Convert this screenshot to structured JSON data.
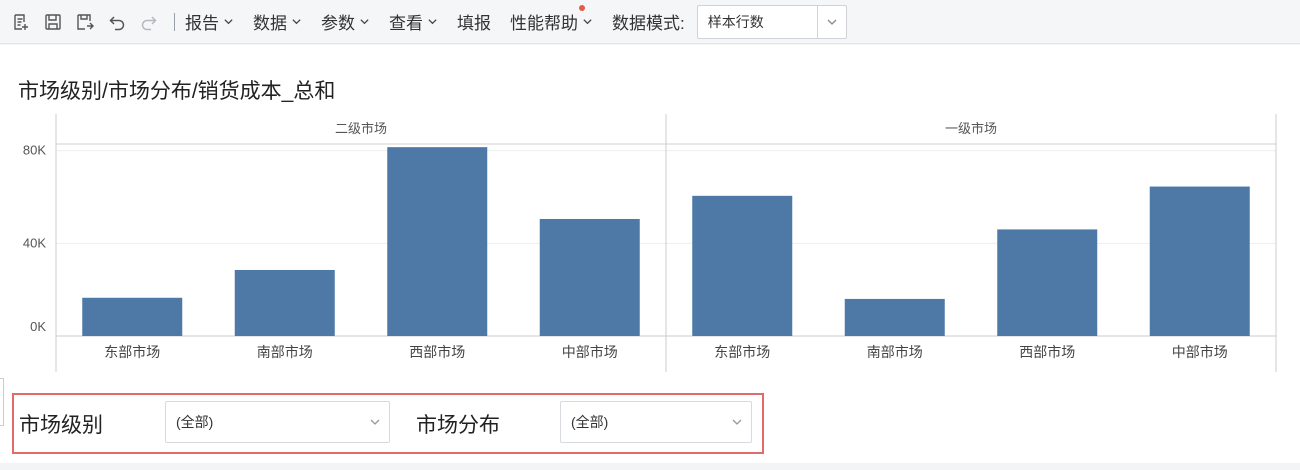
{
  "toolbar": {
    "icons": [
      "new-report-icon",
      "save-icon",
      "save-as-icon",
      "undo-icon",
      "redo-icon"
    ],
    "menus": [
      {
        "label": "报告",
        "dot": false
      },
      {
        "label": "数据",
        "dot": false
      },
      {
        "label": "参数",
        "dot": false
      },
      {
        "label": "查看",
        "dot": false
      },
      {
        "label": "填报",
        "dot": false,
        "nochev": true
      },
      {
        "label": "性能帮助",
        "dot": true
      }
    ],
    "data_mode_label": "数据模式:",
    "data_mode_value": "样本行数"
  },
  "colors": {
    "bar": "#4e79a7",
    "dot": "#e45b4a",
    "filter_border": "#e26a6a"
  },
  "chart_title": "市场级别/市场分布/销货成本_总和",
  "chart_data": {
    "type": "bar",
    "title": "市场级别/市场分布/销货成本_总和",
    "ylim": [
      0,
      82000
    ],
    "yticks": [
      {
        "value": 0,
        "label": "0K"
      },
      {
        "value": 40000,
        "label": "40K"
      },
      {
        "value": 80000,
        "label": "80K"
      }
    ],
    "grid": true,
    "panels": [
      {
        "name": "二级市场",
        "categories": [
          "东部市场",
          "南部市场",
          "西部市场",
          "中部市场"
        ],
        "values": [
          16500,
          28500,
          81500,
          50500
        ]
      },
      {
        "name": "一级市场",
        "categories": [
          "东部市场",
          "南部市场",
          "西部市场",
          "中部市场"
        ],
        "values": [
          60500,
          16000,
          46000,
          64500
        ]
      }
    ]
  },
  "filters": [
    {
      "label": "市场级别",
      "value": "(全部)"
    },
    {
      "label": "市场分布",
      "value": "(全部)"
    }
  ]
}
